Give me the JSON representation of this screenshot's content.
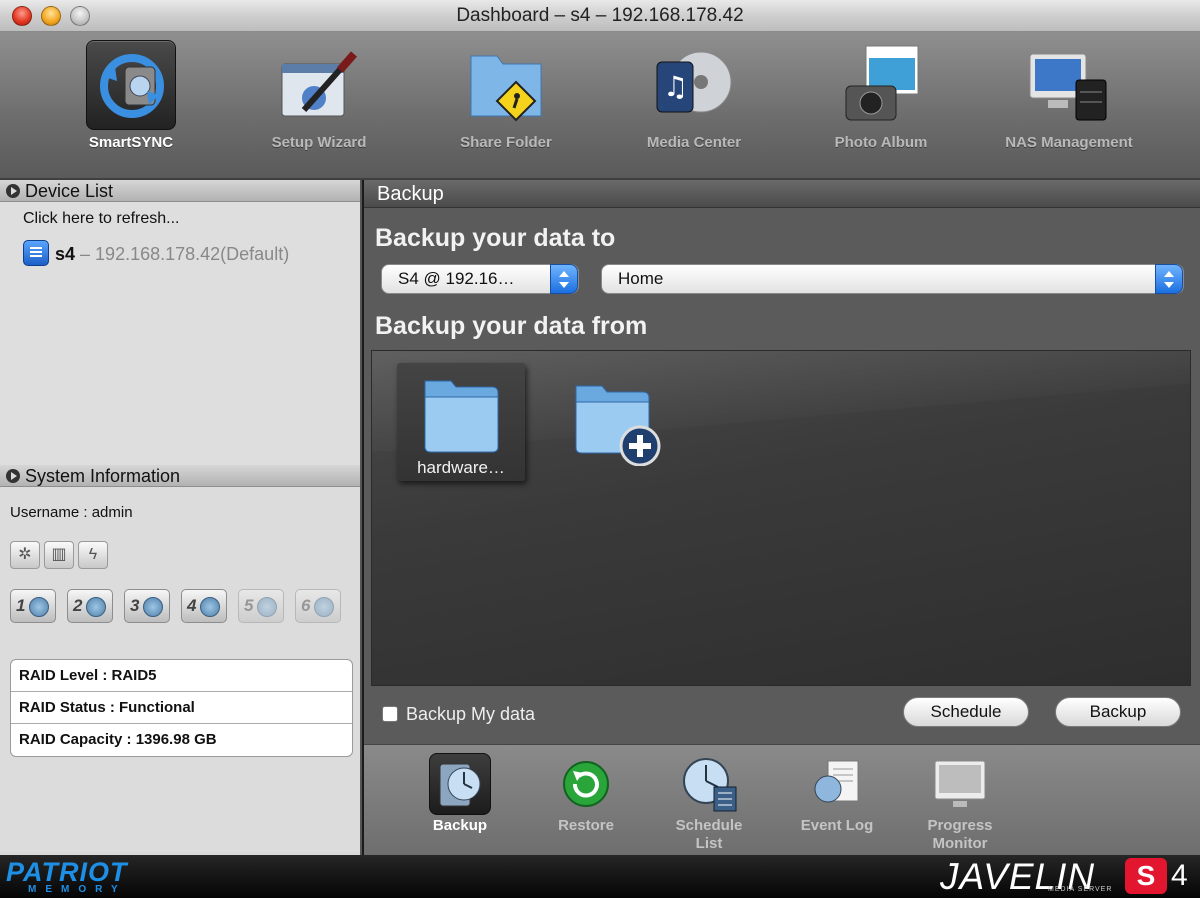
{
  "window": {
    "title": "Dashboard – s4 – 192.168.178.42"
  },
  "toolbar": {
    "items": [
      {
        "label": "SmartSYNC",
        "icon": "smartsync-icon",
        "active": true
      },
      {
        "label": "Setup Wizard",
        "icon": "setup-wizard-icon"
      },
      {
        "label": "Share Folder",
        "icon": "share-folder-icon"
      },
      {
        "label": "Media Center",
        "icon": "media-center-icon"
      },
      {
        "label": "Photo Album",
        "icon": "photo-album-icon"
      },
      {
        "label": "NAS Management",
        "icon": "nas-management-icon"
      }
    ]
  },
  "device_list": {
    "header": "Device List",
    "refresh": "Click here to refresh...",
    "device_name": "s4",
    "device_detail": " – 192.168.178.42(Default)"
  },
  "system_info": {
    "header": "System Information",
    "username": "Username : admin",
    "disks": [
      "1",
      "2",
      "3",
      "4",
      "5",
      "6"
    ],
    "raid_level": "RAID Level : RAID5",
    "raid_status": "RAID Status : Functional",
    "raid_capacity": "RAID Capacity : 1396.98 GB"
  },
  "main": {
    "header": "Backup",
    "to_heading": "Backup your data to",
    "target_device": "S4 @ 192.16…",
    "target_folder": "Home",
    "from_heading": "Backup your data from",
    "folder_label": "hardware…",
    "checkbox_label": "Backup My data",
    "schedule_label": "Schedule",
    "backup_label": "Backup"
  },
  "bottom_tabs": [
    {
      "label": "Backup",
      "active": true
    },
    {
      "label": "Restore"
    },
    {
      "label": "Schedule\nList"
    },
    {
      "label": "Event Log"
    },
    {
      "label": "Progress\nMonitor"
    }
  ],
  "footer": {
    "brand_left": "PATRIOT",
    "brand_left_sub": "MEMORY",
    "brand_right": "JAVELIN",
    "brand_right_sub": "MEDIA SERVER",
    "badge": "S",
    "badge_num": "4"
  }
}
